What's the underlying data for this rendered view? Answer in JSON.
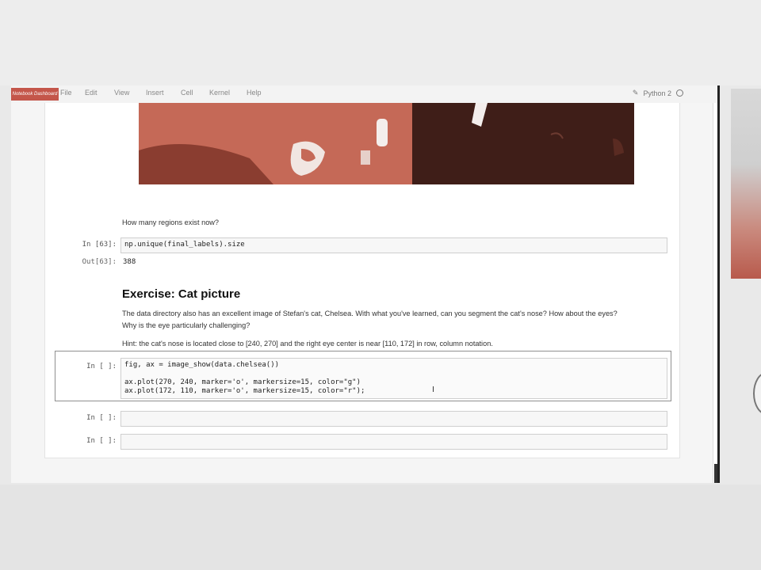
{
  "menubar": {
    "logo_text": "Notebook Dashboard",
    "items": [
      "File",
      "Edit",
      "View",
      "Insert",
      "Cell",
      "Kernel",
      "Help"
    ],
    "kernel_name": "Python 2"
  },
  "cells": {
    "md_regions": "How many regions exist now?",
    "cell63": {
      "prompt": "In [63]:",
      "code": "np.unique(final_labels).size",
      "out_prompt": "Out[63]:",
      "output": "388"
    },
    "exercise_heading": "Exercise: Cat picture",
    "exercise_text_1": "The data directory also has an excellent image of Stefan's cat, Chelsea. With what you've learned, can you segment the cat's nose? How about the eyes?",
    "exercise_text_2": "Why is the eye particularly challenging?",
    "hint_text": "Hint: the cat's nose is located close to [240, 270] and the right eye center is near [110, 172] in row, column notation.",
    "active_cell": {
      "prompt": "In [ ]:",
      "lines": [
        "fig, ax = image_show(data.chelsea())",
        "",
        "ax.plot(270, 240, marker='o', markersize=15, color=\"g\")",
        "ax.plot(172, 110, marker='o', markersize=15, color=\"r\");"
      ]
    },
    "empty_cell_1": {
      "prompt": "In [ ]:"
    },
    "empty_cell_2": {
      "prompt": "In [ ]:"
    }
  },
  "colors": {
    "image_main": "#c56957",
    "image_dark": "#3f1e18",
    "logo": "#c4564a"
  }
}
